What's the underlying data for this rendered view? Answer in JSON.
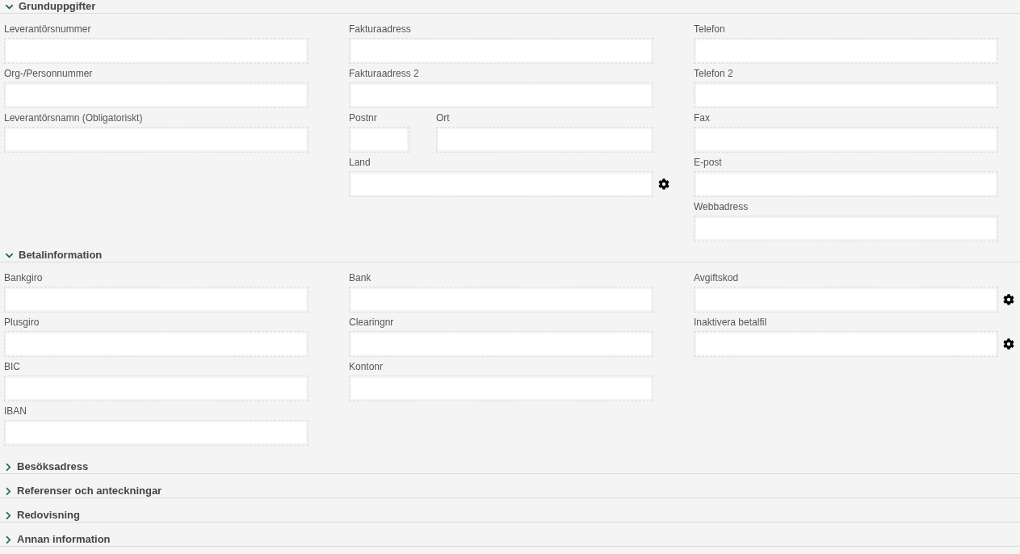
{
  "sections": [
    {
      "title": "Grunduppgifter",
      "expanded": true,
      "columns": [
        [
          {
            "kind": "text",
            "label": "Leverantörsnummer"
          },
          {
            "kind": "text",
            "label": "Org-/Personnummer"
          },
          {
            "kind": "text",
            "label": "Leverantörsnamn (Obligatoriskt)"
          }
        ],
        [
          {
            "kind": "text",
            "label": "Fakturaadress"
          },
          {
            "kind": "text",
            "label": "Fakturaadress 2"
          },
          {
            "kind": "pair",
            "fields": [
              {
                "label": "Postnr"
              },
              {
                "label": "Ort"
              }
            ]
          },
          {
            "kind": "settings",
            "label": "Land"
          }
        ],
        [
          {
            "kind": "text",
            "label": "Telefon"
          },
          {
            "kind": "text",
            "label": "Telefon 2"
          },
          {
            "kind": "text",
            "label": "Fax"
          },
          {
            "kind": "text",
            "label": "E-post"
          },
          {
            "kind": "text",
            "label": "Webbadress"
          }
        ]
      ]
    },
    {
      "title": "Betalinformation",
      "expanded": true,
      "columns": [
        [
          {
            "kind": "text",
            "label": "Bankgiro"
          },
          {
            "kind": "text",
            "label": "Plusgiro"
          },
          {
            "kind": "text",
            "label": "BIC"
          },
          {
            "kind": "text",
            "label": "IBAN"
          }
        ],
        [
          {
            "kind": "text",
            "label": "Bank"
          },
          {
            "kind": "text",
            "label": "Clearingnr"
          },
          {
            "kind": "text",
            "label": "Kontonr"
          }
        ],
        [
          {
            "kind": "settings",
            "label": "Avgiftskod"
          },
          {
            "kind": "settings",
            "label": "Inaktivera betalfil"
          }
        ]
      ]
    },
    {
      "title": "Besöksadress",
      "expanded": false
    },
    {
      "title": "Referenser och anteckningar",
      "expanded": false
    },
    {
      "title": "Redovisning",
      "expanded": false
    },
    {
      "title": "Annan information",
      "expanded": false
    }
  ]
}
